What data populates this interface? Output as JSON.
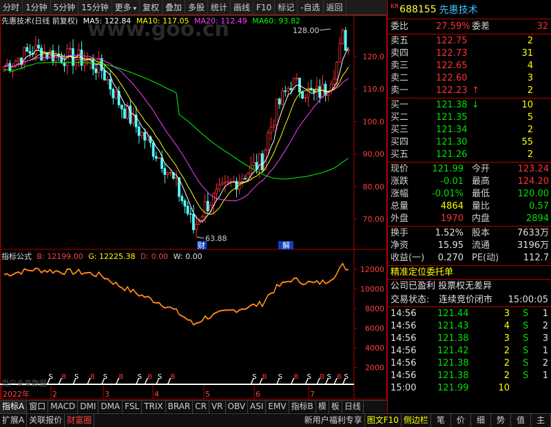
{
  "toolbar": {
    "items": [
      "分时",
      "1分钟",
      "5分钟",
      "15分钟",
      "更多",
      "复权",
      "叠加",
      "多股",
      "统计",
      "画线",
      "F10",
      "标记",
      "-自选",
      "返回"
    ]
  },
  "watermark": "www.goo.cn",
  "main_legend": {
    "title": "先惠技术(日线 前复权)",
    "ma5": "MA5: 122.84",
    "ma10": "MA10: 117.05",
    "ma20": "MA20: 112.49",
    "ma60": "MA60: 93.82",
    "colors": {
      "ma5": "#ffffff",
      "ma10": "#ffff00",
      "ma20": "#ff40ff",
      "ma60": "#00ff00"
    }
  },
  "sub_legend": {
    "title": "指标公式",
    "b": "B: 12199.00",
    "g": "G: 12225.38",
    "d": "D: 0.00",
    "w": "W: 0.00"
  },
  "annotations": {
    "high": "128.00",
    "low": "63.88",
    "cai": "财",
    "jie": "解"
  },
  "signals": {
    "buy": "B",
    "sell": "S"
  },
  "chart_data": [
    {
      "type": "line",
      "name": "candlestick-price",
      "y_ticks": [
        "120.0",
        "110.0",
        "100.0",
        "90.00",
        "80.00",
        "70.00"
      ],
      "high": 128.0,
      "low": 63.88,
      "ma": {
        "MA5": 122.84,
        "MA10": 117.05,
        "MA20": 112.49,
        "MA60": 93.82
      }
    },
    {
      "type": "line",
      "name": "indicator",
      "y_ticks": [
        "12000",
        "10000",
        "8000",
        "6000",
        "4000",
        "2000"
      ],
      "x_ticks": [
        "2022年",
        "2",
        "3",
        "4",
        "5",
        "6",
        "7"
      ],
      "last_b": 12199.0,
      "last_g": 12225.38
    }
  ],
  "quote": {
    "kr": "KR",
    "code": "688155",
    "name": "先惠技术",
    "weibi_label": "委比",
    "weibi": "27.59%",
    "weicha_label": "委差",
    "weicha": "32",
    "asks": [
      {
        "label": "卖五",
        "price": "122.75",
        "vol": "2"
      },
      {
        "label": "卖四",
        "price": "122.73",
        "vol": "31"
      },
      {
        "label": "卖三",
        "price": "122.65",
        "vol": "4"
      },
      {
        "label": "卖二",
        "price": "122.60",
        "vol": "3"
      },
      {
        "label": "卖一",
        "price": "122.23",
        "vol": "2",
        "arrow": "↑"
      }
    ],
    "bids": [
      {
        "label": "买一",
        "price": "121.38",
        "vol": "10",
        "arrow": "↓"
      },
      {
        "label": "买二",
        "price": "121.35",
        "vol": "5"
      },
      {
        "label": "买三",
        "price": "121.34",
        "vol": "2"
      },
      {
        "label": "买四",
        "price": "121.30",
        "vol": "55"
      },
      {
        "label": "买五",
        "price": "121.26",
        "vol": "2"
      }
    ],
    "stats": [
      {
        "l1": "现价",
        "v1": "121.99",
        "c1": "green",
        "l2": "今开",
        "v2": "123.24",
        "c2": "red"
      },
      {
        "l1": "涨跌",
        "v1": "-0.01",
        "c1": "green",
        "l2": "最高",
        "v2": "124.20",
        "c2": "red"
      },
      {
        "l1": "涨幅",
        "v1": "-0.01%",
        "c1": "green",
        "l2": "最低",
        "v2": "120.00",
        "c2": "green"
      },
      {
        "l1": "总量",
        "v1": "4864",
        "c1": "yellow",
        "l2": "量比",
        "v2": "0.57",
        "c2": "green"
      },
      {
        "l1": "外盘",
        "v1": "1970",
        "c1": "red",
        "l2": "内盘",
        "v2": "2894",
        "c2": "green"
      }
    ],
    "stats2": [
      {
        "l1": "换手",
        "v1": "1.52%",
        "l2": "股本",
        "v2": "7633万"
      },
      {
        "l1": "净资",
        "v1": "15.95",
        "l2": "流通",
        "v2": "3196万"
      },
      {
        "l1": "收益(一)",
        "v1": "0.270",
        "l2": "PE(动)",
        "v2": "112.7"
      }
    ],
    "promo": "精准定位委托单",
    "info1": "公司已盈利 投票权无差异",
    "status_label": "交易状态:",
    "status_value": "连续竞价闭市",
    "status_time": "15:00:05",
    "ticks": [
      {
        "time": "14:56",
        "price": "121.44",
        "vol": "3",
        "side": "S",
        "n": "1"
      },
      {
        "time": "14:56",
        "price": "121.43",
        "vol": "4",
        "side": "S",
        "n": "2"
      },
      {
        "time": "14:56",
        "price": "121.38",
        "vol": "3",
        "side": "S",
        "n": "3"
      },
      {
        "time": "14:56",
        "price": "121.42",
        "vol": "2",
        "side": "S",
        "n": "1"
      },
      {
        "time": "14:56",
        "price": "121.38",
        "vol": "2",
        "side": "S",
        "n": "2"
      },
      {
        "time": "14:56",
        "price": "121.38",
        "vol": "2",
        "side": "S",
        "n": "1"
      },
      {
        "time": "15:00",
        "price": "121.99",
        "vol": "10",
        "side": "",
        "n": ""
      }
    ]
  },
  "tabs_bottom": [
    "指标A",
    "窗口",
    "MACD",
    "DMI",
    "DMA",
    "FSL",
    "TRIX",
    "BRAR",
    "CR",
    "VR",
    "OBV",
    "ASI",
    "EMV",
    "指标B",
    "模",
    "板",
    "日线"
  ],
  "statusbar": {
    "left": [
      "扩展A",
      "关联报价",
      "财富圈"
    ],
    "right": [
      "新用户福利专享",
      "图文F10",
      "侧边栏",
      "笔",
      "价",
      "细",
      "势",
      "值",
      "主"
    ]
  },
  "misc": {
    "bottom_left_text": "用户未来数据",
    "add": "+",
    "minus": "-"
  }
}
